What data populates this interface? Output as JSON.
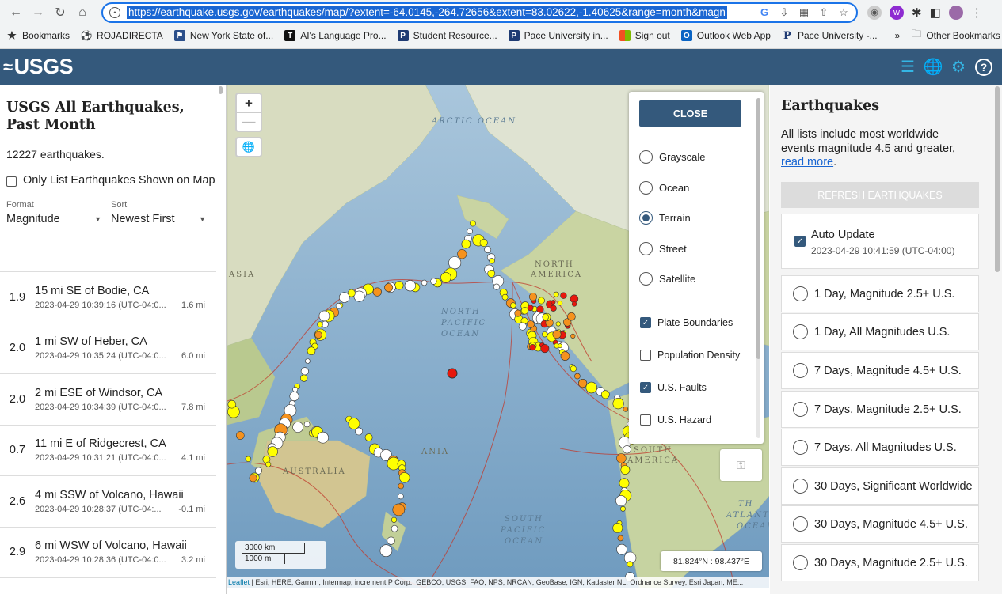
{
  "browser": {
    "url": "https://earthquake.usgs.gov/earthquakes/map/?extent=-64.0145,-264.72656&extent=83.02622,-1.40625&range=month&magn",
    "bookmarks": [
      {
        "label": "Bookmarks",
        "icon": "star-icon",
        "color": "#333333"
      },
      {
        "label": "ROJADIRECTA",
        "icon": "soccer-icon",
        "color": "#555555"
      },
      {
        "label": "New York State of...",
        "icon": "flag-icon",
        "color": "#2b4f8a"
      },
      {
        "label": "AI's Language Pro...",
        "icon": "T-icon",
        "color": "#111111"
      },
      {
        "label": "Student Resource...",
        "icon": "P-icon",
        "color": "#1f3b73"
      },
      {
        "label": "Pace University in...",
        "icon": "P-icon",
        "color": "#1f3b73"
      },
      {
        "label": "Sign out",
        "icon": "microsoft-icon",
        "color": "#f25022"
      },
      {
        "label": "Outlook Web App",
        "icon": "outlook-icon",
        "color": "#0a64c4"
      },
      {
        "label": "Pace University -...",
        "icon": "P-serif-icon",
        "color": "#1f3b73"
      }
    ],
    "overflow_label": "»",
    "other_bookmarks": "Other Bookmarks"
  },
  "header": {
    "logo": "USGS"
  },
  "list": {
    "title": "USGS All Earthquakes, Past Month",
    "count": "12227 earthquakes.",
    "only_list_label": "Only List Earthquakes Shown on Map",
    "format_label": "Format",
    "format_value": "Magnitude",
    "sort_label": "Sort",
    "sort_value": "Newest First",
    "items": [
      {
        "mag": "1.9",
        "place": "15 mi SE of Bodie, CA",
        "time": "2023-04-29 10:39:16 (UTC-04:0...",
        "depth": "1.6 mi"
      },
      {
        "mag": "2.0",
        "place": "1 mi SW of Heber, CA",
        "time": "2023-04-29 10:35:24 (UTC-04:0...",
        "depth": "6.0 mi"
      },
      {
        "mag": "2.0",
        "place": "2 mi ESE of Windsor, CA",
        "time": "2023-04-29 10:34:39 (UTC-04:0...",
        "depth": "7.8 mi"
      },
      {
        "mag": "0.7",
        "place": "11 mi E of Ridgecrest, CA",
        "time": "2023-04-29 10:31:21 (UTC-04:0...",
        "depth": "4.1 mi"
      },
      {
        "mag": "2.6",
        "place": "4 mi SSW of Volcano, Hawaii",
        "time": "2023-04-29 10:28:37 (UTC-04:...",
        "depth": "-0.1 mi"
      },
      {
        "mag": "2.9",
        "place": "6 mi WSW of Volcano, Hawaii",
        "time": "2023-04-29 10:28:36 (UTC-04:0...",
        "depth": "3.2 mi"
      }
    ]
  },
  "map": {
    "zoom_in": "+",
    "zoom_out": "—",
    "labels": {
      "arctic": "ARCTIC OCEAN",
      "north_america_1": "NORTH",
      "north_america_2": "AMERICA",
      "asia": "ASIA",
      "north_pacific_1": "NORTH",
      "north_pacific_2": "PACIFIC",
      "north_pacific_3": "OCEAN",
      "australia": "AUSTRALIA",
      "south_pacific_1": "SOUTH",
      "south_pacific_2": "PACIFIC",
      "south_pacific_3": "OCEAN",
      "south_america_1": "SOUTH",
      "south_america_2": "AMERICA",
      "oceania": "ANIA",
      "atlantic_1": "TH",
      "atlantic_2": "ATLANT",
      "atlantic_3": "OCEAN"
    },
    "scale_km": "3000 km",
    "scale_mi": "1000 mi",
    "coords": "81.824°N : 98.437°E",
    "attribution_link": "Leaflet",
    "attribution": " | Esri, HERE, Garmin, Intermap, increment P Corp., GEBCO, USGS, FAO, NPS, NRCAN, GeoBase, IGN, Kadaster NL, Ordnance Survey, Esri Japan, ME..."
  },
  "settings": {
    "close": "CLOSE",
    "basemaps": [
      {
        "label": "Grayscale",
        "selected": false
      },
      {
        "label": "Ocean",
        "selected": false
      },
      {
        "label": "Terrain",
        "selected": true
      },
      {
        "label": "Street",
        "selected": false
      },
      {
        "label": "Satellite",
        "selected": false
      }
    ],
    "overlays": [
      {
        "label": "Plate Boundaries",
        "checked": true
      },
      {
        "label": "Population Density",
        "checked": false
      },
      {
        "label": "U.S. Faults",
        "checked": true
      },
      {
        "label": "U.S. Hazard",
        "checked": false
      }
    ]
  },
  "feeds": {
    "title": "Earthquakes",
    "desc": "All lists include most worldwide events magnitude 4.5 and greater, ",
    "read_more": "read more",
    "desc_end": ".",
    "refresh": "REFRESH EARTHQUAKES",
    "auto_update": "Auto Update",
    "auto_time": "2023-04-29 10:41:59 (UTC-04:00)",
    "items": [
      "1 Day, Magnitude 2.5+ U.S.",
      "1 Day, All Magnitudes U.S.",
      "7 Days, Magnitude 4.5+ U.S.",
      "7 Days, Magnitude 2.5+ U.S.",
      "7 Days, All Magnitudes U.S.",
      "30 Days, Significant Worldwide",
      "30 Days, Magnitude 4.5+ U.S.",
      "30 Days, Magnitude 2.5+ U.S."
    ]
  },
  "colors": {
    "header": "#34597c",
    "accent_icon": "#34b6e5",
    "ocean": "#7fa9c8",
    "land": "#c6d6a9",
    "quake_yellow": "#ffff00",
    "quake_orange": "#f5921e",
    "quake_red": "#e8180c",
    "quake_white": "#ffffff"
  }
}
